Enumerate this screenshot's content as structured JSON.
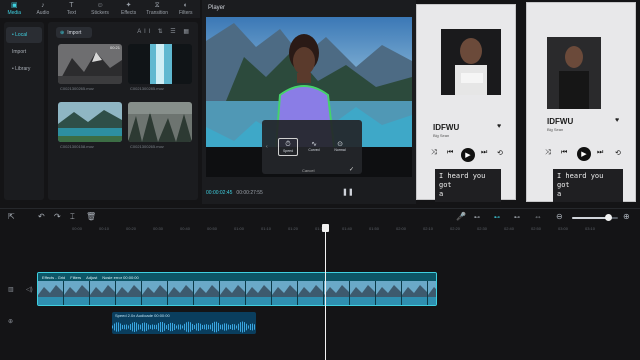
{
  "toolbar": {
    "items": [
      {
        "label": "Media",
        "icon": "media-icon",
        "active": true
      },
      {
        "label": "Audio",
        "icon": "music-note-icon"
      },
      {
        "label": "Text",
        "icon": "text-icon"
      },
      {
        "label": "Stickers",
        "icon": "sticker-icon"
      },
      {
        "label": "Effects",
        "icon": "effects-icon"
      },
      {
        "label": "Transition",
        "icon": "transition-icon"
      },
      {
        "label": "Filters",
        "icon": "filters-icon"
      }
    ]
  },
  "leftnav": {
    "items": [
      {
        "label": "• Local",
        "active": true
      },
      {
        "label": "Import"
      },
      {
        "label": "• Library"
      }
    ]
  },
  "media": {
    "import_label": "Import",
    "tools": "All ⇅ ☰ ▦",
    "thumbs": [
      {
        "name": "C0021300265.mov",
        "duration": "00:21"
      },
      {
        "name": "C0021300285.mov",
        "duration": ""
      },
      {
        "name": "C0021300158.mov",
        "duration": ""
      },
      {
        "name": "C0021300265.mov",
        "duration": ""
      }
    ]
  },
  "player": {
    "title": "Player",
    "current_time": "00:00:02:45",
    "total_time": "00:00:27:55",
    "options": [
      "Speed",
      "Curved",
      "Normal"
    ],
    "cancel_label": "Cancel"
  },
  "cards": [
    {
      "song": "IDFWU",
      "artist": "Big Sean",
      "lyric": [
        "I heard you got",
        "a"
      ]
    },
    {
      "song": "IDFWU",
      "artist": "Big Sean",
      "lyric": [
        "I heard you got",
        "a"
      ]
    }
  ],
  "timeline": {
    "ruler": [
      "00:00",
      "00:10",
      "00:20",
      "00:30",
      "00:40",
      "00:50",
      "01:00",
      "01:10",
      "01:20",
      "01:30",
      "01:40",
      "01:50",
      "02:00",
      "02:10",
      "02:20",
      "02:30",
      "02:40",
      "02:50",
      "03:00",
      "03:10"
    ],
    "main_clip_tags": [
      "Effects - Grid",
      "Filters",
      "Adjust",
      "Nosie error 00:00:00"
    ],
    "audio_clip_label": "Speed 2.0x  Audioade  00:00:00",
    "zoom_level": 0.78
  },
  "colors": {
    "accent": "#3fd0e0",
    "panel": "#1b1c1f",
    "background": "#141416"
  }
}
